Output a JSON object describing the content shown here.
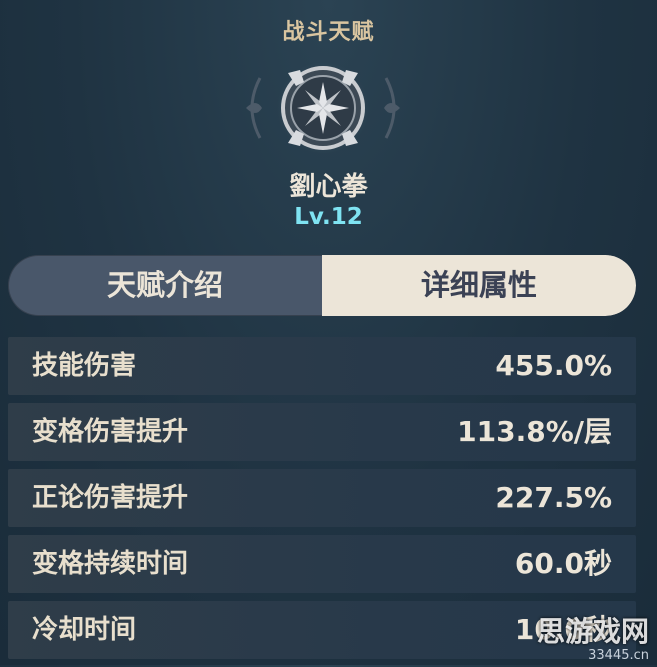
{
  "header": {
    "title": "战斗天赋"
  },
  "skill": {
    "name": "劉心拳",
    "level": "Lv.12",
    "icon": "talent-emblem-icon"
  },
  "tabs": [
    {
      "label": "天赋介绍",
      "active": false
    },
    {
      "label": "详细属性",
      "active": true
    }
  ],
  "attributes": [
    {
      "label": "技能伤害",
      "value": "455.0%"
    },
    {
      "label": "变格伤害提升",
      "value": "113.8%/层"
    },
    {
      "label": "正论伤害提升",
      "value": "227.5%"
    },
    {
      "label": "变格持续时间",
      "value": "60.0秒"
    },
    {
      "label": "冷却时间",
      "value": "10.0秒"
    }
  ],
  "watermark": {
    "title": "思游戏网",
    "url": "33445.cn"
  },
  "colors": {
    "accent_level": "#7fe3f2",
    "tab_active_bg": "#ece5d8",
    "tab_inactive_bg": "#49576a",
    "title_gold": "#d9c5a0"
  }
}
